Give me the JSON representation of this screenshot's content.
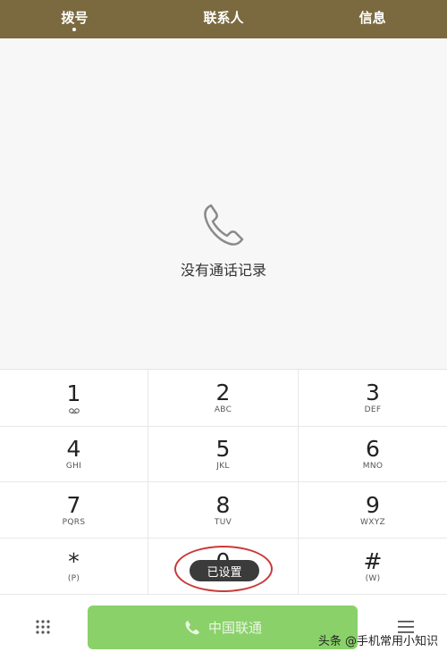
{
  "tabs": [
    {
      "label": "拨号",
      "active": true
    },
    {
      "label": "联系人",
      "active": false
    },
    {
      "label": "信息",
      "active": false
    }
  ],
  "empty_state": {
    "icon": "phone-icon",
    "text": "没有通话记录"
  },
  "keypad": [
    {
      "digit": "1",
      "sub": "",
      "icon": "voicemail-icon"
    },
    {
      "digit": "2",
      "sub": "ABC"
    },
    {
      "digit": "3",
      "sub": "DEF"
    },
    {
      "digit": "4",
      "sub": "GHI"
    },
    {
      "digit": "5",
      "sub": "JKL"
    },
    {
      "digit": "6",
      "sub": "MNO"
    },
    {
      "digit": "7",
      "sub": "PQRS"
    },
    {
      "digit": "8",
      "sub": "TUV"
    },
    {
      "digit": "9",
      "sub": "WXYZ"
    },
    {
      "digit": "*",
      "sub": "(P)"
    },
    {
      "digit": "0",
      "sub": "+"
    },
    {
      "digit": "#",
      "sub": "(W)"
    }
  ],
  "toast": "已设置",
  "call_button": {
    "label": "中国联通"
  },
  "watermark": "头条 @手机常用小知识",
  "colors": {
    "header": "#7b6a3f",
    "call": "#8ad16a",
    "highlight": "#c93a3a"
  }
}
